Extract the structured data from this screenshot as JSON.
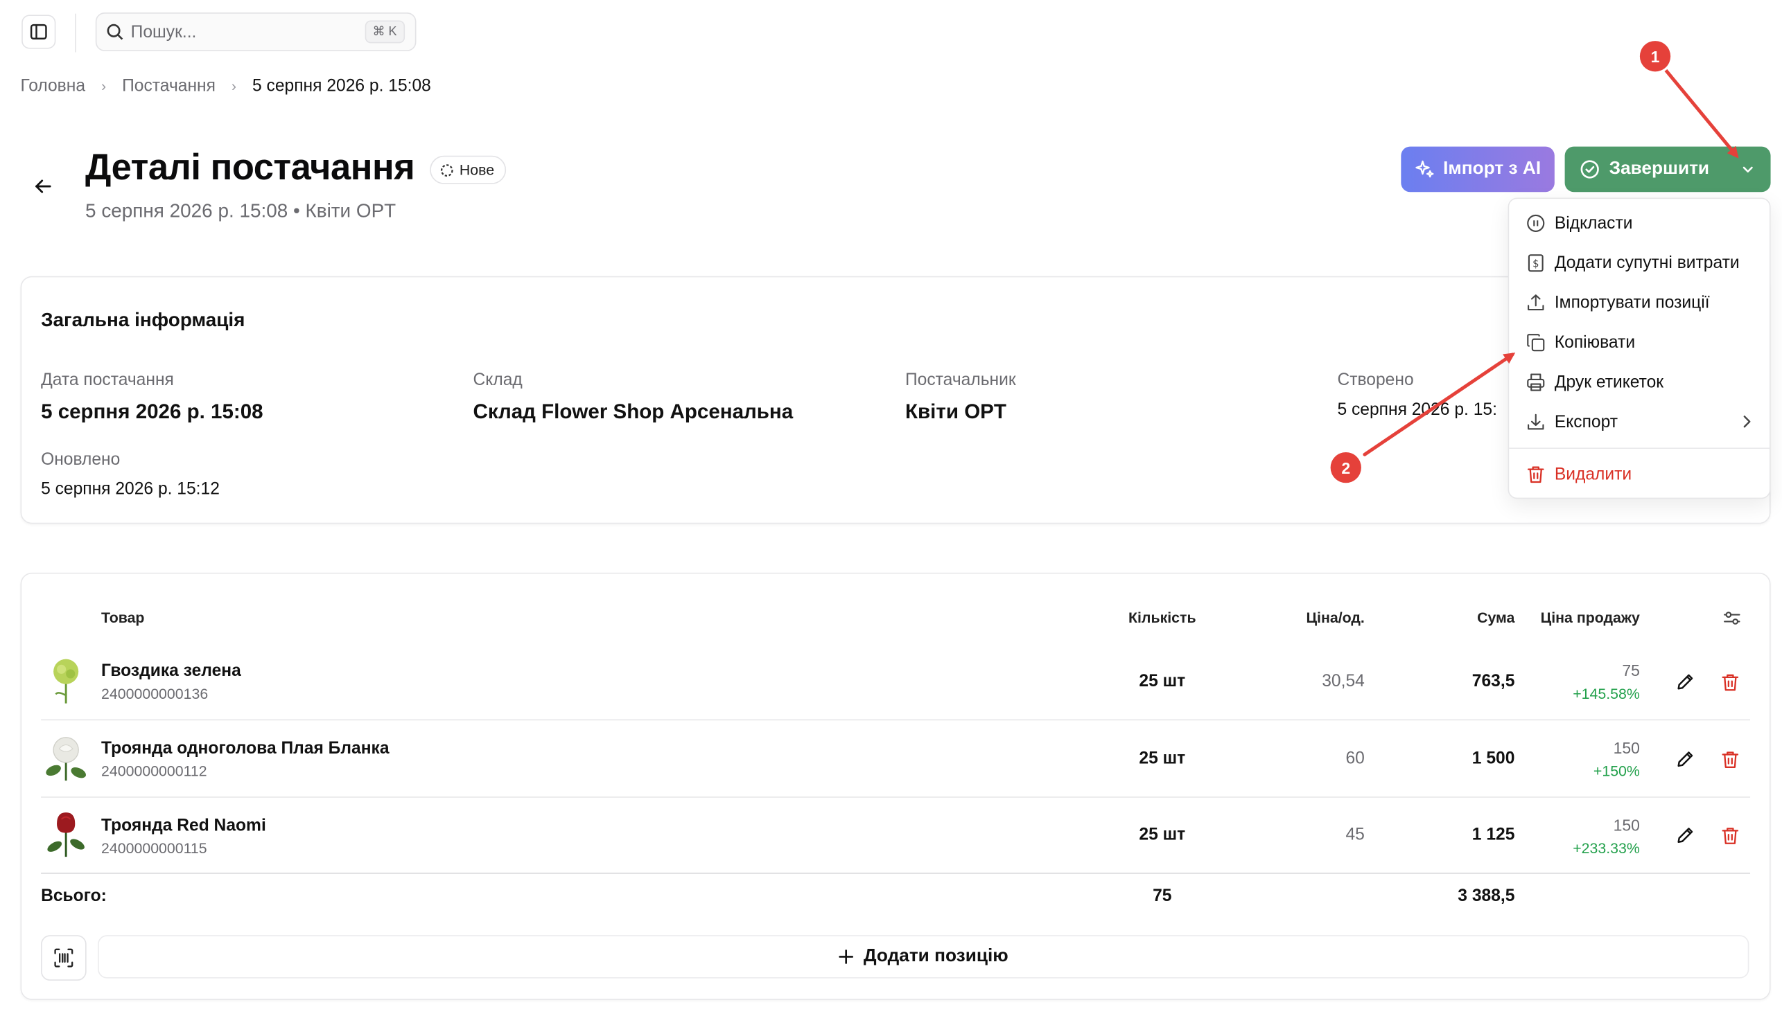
{
  "search": {
    "placeholder": "Пошук...",
    "shortcut": "⌘ K"
  },
  "breadcrumbs": [
    "Головна",
    "Постачання",
    "5 серпня 2026 р. 15:08"
  ],
  "header": {
    "title": "Деталі постачання",
    "status": "Нове",
    "subtitle": "5 серпня 2026 р. 15:08 • Квіти OPT"
  },
  "actions": {
    "import_ai": "Імпорт з AI",
    "complete": "Завершити"
  },
  "menu": {
    "items": [
      {
        "label": "Відкласти",
        "icon": "pause-icon"
      },
      {
        "label": "Додати супутні витрати",
        "icon": "receipt-icon"
      },
      {
        "label": "Імпортувати позиції",
        "icon": "upload-icon"
      },
      {
        "label": "Копіювати",
        "icon": "copy-icon"
      },
      {
        "label": "Друк етикеток",
        "icon": "printer-icon"
      },
      {
        "label": "Експорт",
        "icon": "download-icon"
      }
    ],
    "delete": "Видалити"
  },
  "general": {
    "title": "Загальна інформація",
    "date_label": "Дата постачання",
    "date_value": "5 серпня 2026 р. 15:08",
    "warehouse_label": "Склад",
    "warehouse_value": "Склад Flower Shop Арсенальна",
    "supplier_label": "Постачальник",
    "supplier_value": "Квіти OPT",
    "created_label": "Створено",
    "created_value": "5 серпня 2026 р. 15:",
    "updated_label": "Оновлено",
    "updated_value": "5 серпня 2026 р. 15:12"
  },
  "table": {
    "headers": {
      "product": "Товар",
      "qty": "Кількість",
      "price": "Ціна/од.",
      "sum": "Сума",
      "sale": "Ціна продажу"
    },
    "rows": [
      {
        "name": "Гвоздика зелена",
        "sku": "2400000000136",
        "qty": "25 шт",
        "price": "30,54",
        "sum": "763,5",
        "sale": "75",
        "markup": "+145.58%",
        "thumb_color": "#a6c94a"
      },
      {
        "name": "Троянда одноголова Плая Бланка",
        "sku": "2400000000112",
        "qty": "25 шт",
        "price": "60",
        "sum": "1 500",
        "sale": "150",
        "markup": "+150%",
        "thumb_color": "#f2f2ee"
      },
      {
        "name": "Троянда Red Naomi",
        "sku": "2400000000115",
        "qty": "25 шт",
        "price": "45",
        "sum": "1 125",
        "sale": "150",
        "markup": "+233.33%",
        "thumb_color": "#9c1a1f"
      }
    ],
    "total_label": "Всього:",
    "total_qty": "75",
    "total_sum": "3 388,5",
    "add_label": "Додати позицію"
  },
  "annotations": {
    "marker1": "1",
    "marker2": "2",
    "color": "#e5413a"
  },
  "colors": {
    "primary": "#4e9a6a",
    "danger": "#d93025",
    "positive": "#22a04b"
  }
}
